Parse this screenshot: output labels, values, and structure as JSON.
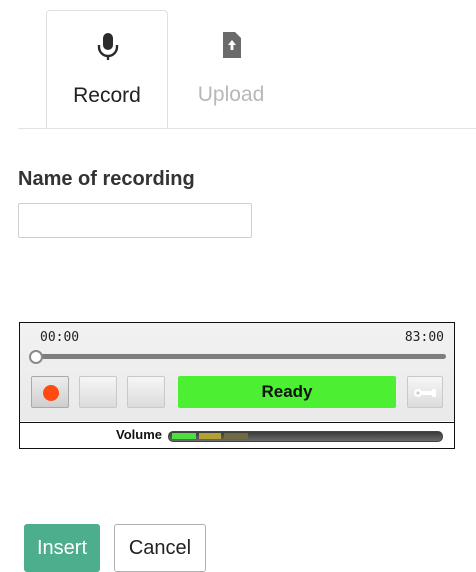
{
  "tabs": [
    {
      "label": "Record",
      "icon": "microphone-icon",
      "active": true
    },
    {
      "label": "Upload",
      "icon": "upload-file-icon",
      "active": false
    }
  ],
  "form": {
    "name_label": "Name of recording",
    "name_value": "",
    "name_placeholder": ""
  },
  "recorder": {
    "time_start": "00:00",
    "time_end": "83:00",
    "progress": 0,
    "status": "Ready",
    "status_color": "#4def33",
    "record_color": "#ff4a12",
    "volume_label": "Volume",
    "buttons": [
      "record-icon",
      "play-icon",
      "stop-icon",
      "settings-wrench-icon"
    ]
  },
  "actions": {
    "insert_label": "Insert",
    "cancel_label": "Cancel",
    "insert_color": "#4cae8c"
  }
}
